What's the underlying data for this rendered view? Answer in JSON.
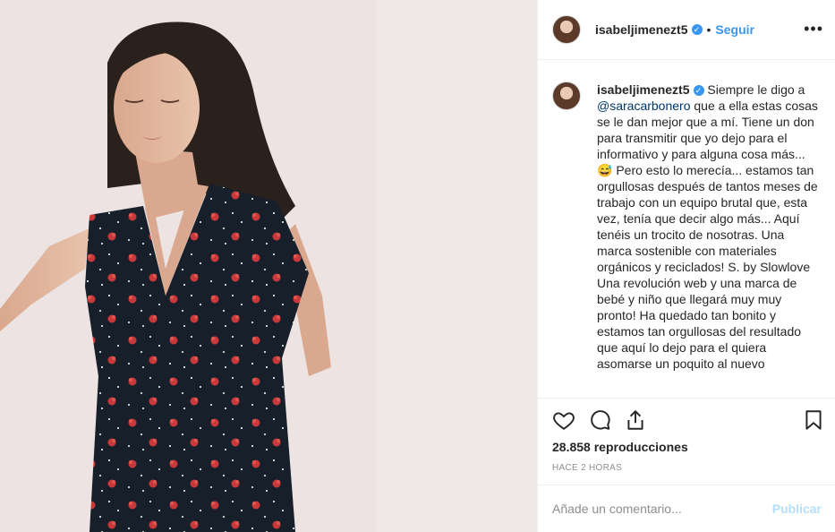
{
  "post": {
    "username": "isabeljimenezt5",
    "verified_glyph": "✓",
    "separator": "•",
    "follow_label": "Seguir",
    "more_label": "•••"
  },
  "caption": {
    "username": "isabeljimenezt5",
    "text_before_mention": " Siempre le digo a ",
    "mention": "@saracarbonero",
    "text_after_mention": " que a ella estas cosas se le dan mejor que a mí. Tiene un don para transmitir que yo dejo para el informativo y para alguna cosa más... 😅 Pero esto lo merecía... estamos tan orgullosas después de tantos meses de trabajo con un equipo brutal que, esta vez, tenía que decir algo más... Aquí tenéis un trocito de nosotras. Una marca sostenible con materiales orgánicos y reciclados! S. by Slowlove\nUna revolución web y una marca de bebé y niño que llegará muy muy pronto! Ha quedado tan bonito y estamos tan orgullosas del resultado que aquí lo dejo para el quiera asomarse un poquito al nuevo"
  },
  "stats": {
    "views": "28.858 reproducciones",
    "time": "HACE 2 HORAS"
  },
  "comment": {
    "placeholder": "Añade un comentario...",
    "publish_label": "Publicar"
  },
  "icons": {
    "like": "heart-icon",
    "comment": "comment-icon",
    "share": "share-icon",
    "save": "bookmark-icon",
    "more": "more-options-icon"
  },
  "colors": {
    "accent": "#3897f0",
    "publish_disabled": "#b2dffc",
    "secondary_text": "#8e8e8e",
    "mention": "#003569"
  }
}
